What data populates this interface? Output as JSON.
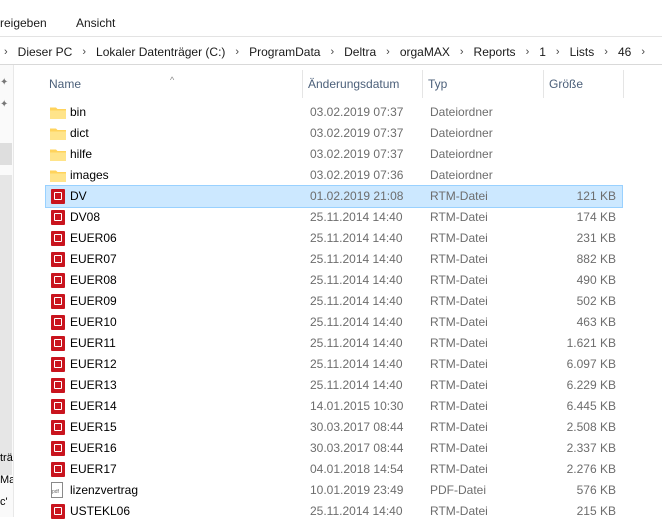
{
  "ribbon": {
    "tabs": [
      "reigeben",
      "Ansicht"
    ]
  },
  "breadcrumb": [
    "Dieser PC",
    "Lokaler Datenträger (C:)",
    "ProgramData",
    "Deltra",
    "orgaMAX",
    "Reports",
    "1",
    "Lists",
    "46"
  ],
  "nav_fragments": [
    "trä",
    "Ma",
    "c'"
  ],
  "columns": {
    "name": "Name",
    "date": "Änderungsdatum",
    "type": "Typ",
    "size": "Größe"
  },
  "files": [
    {
      "name": "bin",
      "date": "03.02.2019 07:37",
      "type": "Dateiordner",
      "size": "",
      "icon": "folder-icon"
    },
    {
      "name": "dict",
      "date": "03.02.2019 07:37",
      "type": "Dateiordner",
      "size": "",
      "icon": "folder-icon"
    },
    {
      "name": "hilfe",
      "date": "03.02.2019 07:37",
      "type": "Dateiordner",
      "size": "",
      "icon": "folder-icon"
    },
    {
      "name": "images",
      "date": "03.02.2019 07:36",
      "type": "Dateiordner",
      "size": "",
      "icon": "folder-icon"
    },
    {
      "name": "DV",
      "date": "01.02.2019 21:08",
      "type": "RTM-Datei",
      "size": "121 KB",
      "icon": "rtm-file-icon",
      "selected": true
    },
    {
      "name": "DV08",
      "date": "25.11.2014 14:40",
      "type": "RTM-Datei",
      "size": "174 KB",
      "icon": "rtm-file-icon"
    },
    {
      "name": "EUER06",
      "date": "25.11.2014 14:40",
      "type": "RTM-Datei",
      "size": "231 KB",
      "icon": "rtm-file-icon"
    },
    {
      "name": "EUER07",
      "date": "25.11.2014 14:40",
      "type": "RTM-Datei",
      "size": "882 KB",
      "icon": "rtm-file-icon"
    },
    {
      "name": "EUER08",
      "date": "25.11.2014 14:40",
      "type": "RTM-Datei",
      "size": "490 KB",
      "icon": "rtm-file-icon"
    },
    {
      "name": "EUER09",
      "date": "25.11.2014 14:40",
      "type": "RTM-Datei",
      "size": "502 KB",
      "icon": "rtm-file-icon"
    },
    {
      "name": "EUER10",
      "date": "25.11.2014 14:40",
      "type": "RTM-Datei",
      "size": "463 KB",
      "icon": "rtm-file-icon"
    },
    {
      "name": "EUER11",
      "date": "25.11.2014 14:40",
      "type": "RTM-Datei",
      "size": "1.621 KB",
      "icon": "rtm-file-icon"
    },
    {
      "name": "EUER12",
      "date": "25.11.2014 14:40",
      "type": "RTM-Datei",
      "size": "6.097 KB",
      "icon": "rtm-file-icon"
    },
    {
      "name": "EUER13",
      "date": "25.11.2014 14:40",
      "type": "RTM-Datei",
      "size": "6.229 KB",
      "icon": "rtm-file-icon"
    },
    {
      "name": "EUER14",
      "date": "14.01.2015 10:30",
      "type": "RTM-Datei",
      "size": "6.445 KB",
      "icon": "rtm-file-icon"
    },
    {
      "name": "EUER15",
      "date": "30.03.2017 08:44",
      "type": "RTM-Datei",
      "size": "2.508 KB",
      "icon": "rtm-file-icon"
    },
    {
      "name": "EUER16",
      "date": "30.03.2017 08:44",
      "type": "RTM-Datei",
      "size": "2.337 KB",
      "icon": "rtm-file-icon"
    },
    {
      "name": "EUER17",
      "date": "04.01.2018 14:54",
      "type": "RTM-Datei",
      "size": "2.276 KB",
      "icon": "rtm-file-icon"
    },
    {
      "name": "lizenzvertrag",
      "date": "10.01.2019 23:49",
      "type": "PDF-Datei",
      "size": "576 KB",
      "icon": "pdf-file-icon"
    },
    {
      "name": "USTEKL06",
      "date": "25.11.2014 14:40",
      "type": "RTM-Datei",
      "size": "215 KB",
      "icon": "rtm-file-icon"
    }
  ],
  "colors": {
    "selection": "#cce8ff",
    "selection_border": "#99d1ff",
    "header_text": "#4c607a",
    "folder": "#ffd35c",
    "rtm_icon": "#c9141e"
  }
}
